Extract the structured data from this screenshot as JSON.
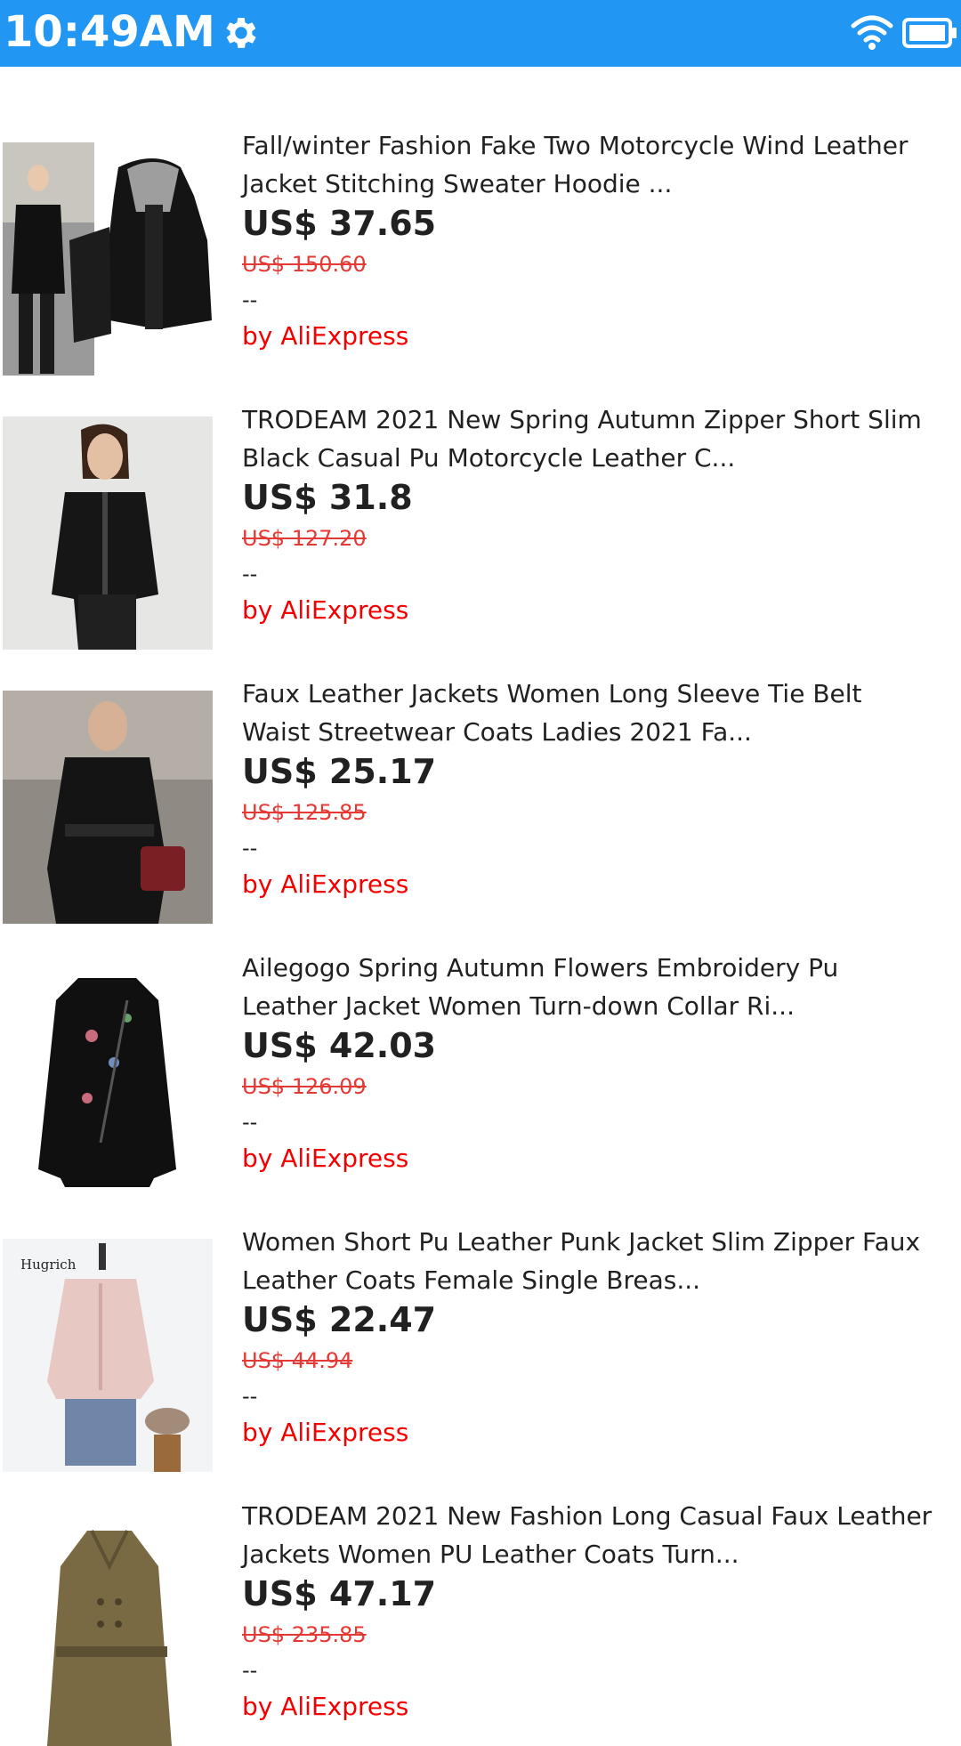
{
  "status_bar": {
    "time": "10:49AM",
    "icons": [
      "gear-icon",
      "wifi-icon",
      "battery-icon"
    ],
    "background": "#2196F3"
  },
  "products": [
    {
      "title_line1": "Fall/winter Fashion Fake Two Motorcycle Wind Leather",
      "title_line2": "Jacket Stitching Sweater Hoodie ...",
      "price": "US$ 37.65",
      "original_price": "US$ 150.60",
      "rating": "--",
      "seller": "by AliExpress",
      "image": "black-leather-hooded-jacket"
    },
    {
      "title_line1": "TRODEAM 2021 New Spring Autumn Zipper Short Slim",
      "title_line2": "Black Casual Pu Motorcycle Leather C...",
      "price": "US$ 31.8",
      "original_price": "US$ 127.20",
      "rating": "--",
      "seller": "by AliExpress",
      "image": "woman-black-leather-jacket"
    },
    {
      "title_line1": "Faux Leather Jackets Women Long Sleeve Tie Belt",
      "title_line2": "Waist Streetwear Coats Ladies 2021 Fa...",
      "price": "US$ 25.17",
      "original_price": "US$ 125.85",
      "rating": "--",
      "seller": "by AliExpress",
      "image": "belted-leather-coat-street"
    },
    {
      "title_line1": "Ailegogo Spring Autumn Flowers Embroidery Pu",
      "title_line2": "Leather Jacket Women Turn-down Collar Ri...",
      "price": "US$ 42.03",
      "original_price": "US$ 126.09",
      "rating": "--",
      "seller": "by AliExpress",
      "image": "embroidered-black-jacket"
    },
    {
      "title_line1": "Women Short Pu Leather Punk Jacket Slim Zipper Faux",
      "title_line2": "Leather Coats Female Single Breas...",
      "price": "US$ 22.47",
      "original_price": "US$ 44.94",
      "rating": "--",
      "seller": "by AliExpress",
      "image": "pink-leather-jacket-mannequin",
      "image_caption": "Hugrich"
    },
    {
      "title_line1": "TRODEAM 2021 New Fashion Long Casual Faux Leather",
      "title_line2": "Jackets Women PU Leather Coats Turn...",
      "price": "US$ 47.17",
      "original_price": "US$ 235.85",
      "rating": "--",
      "seller": "by AliExpress",
      "image": "olive-long-trench-coat"
    }
  ]
}
